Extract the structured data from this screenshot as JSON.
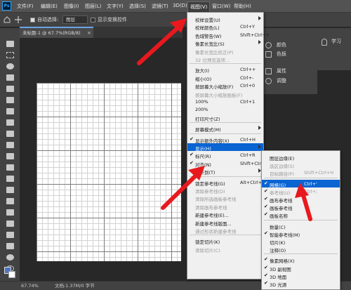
{
  "menubar": {
    "items": [
      "文件(F)",
      "编辑(E)",
      "图像(I)",
      "图层(L)",
      "文字(Y)",
      "选择(S)",
      "滤镜(T)",
      "3D(D)",
      "视图(V)",
      "窗口(W)",
      "帮助(H)"
    ]
  },
  "options": {
    "auto_select": "自动选择:",
    "layer_select": "图层",
    "show_transform": "显示变换控件"
  },
  "doc": {
    "tab": "未标题-1 @ 67.7%(RGB/8)",
    "close": "×"
  },
  "status": {
    "zoom": "67.74%",
    "docinfo": "文档:1.37M/0 字节"
  },
  "panels": {
    "color": "颜色",
    "swatches": "色板",
    "learn": "学习",
    "properties": "属性",
    "adjustments": "调整"
  },
  "view_menu": {
    "items": [
      {
        "label": "校样设置(U)",
        "shortcut": "",
        "arrow": true
      },
      {
        "label": "校样颜色(L)",
        "shortcut": "Ctrl+Y"
      },
      {
        "label": "色域警告(W)",
        "shortcut": "Shift+Ctrl+Y"
      },
      {
        "label": "像素长宽比(S)",
        "shortcut": "",
        "arrow": true
      },
      {
        "label": "像素长宽比校正(P)",
        "shortcut": "",
        "disabled": true
      },
      {
        "label": "32 位预览选项...",
        "shortcut": "",
        "disabled": true
      },
      {
        "label": "放大(I)",
        "shortcut": "Ctrl++"
      },
      {
        "label": "缩小(O)",
        "shortcut": "Ctrl+-"
      },
      {
        "label": "按屏幕大小缩放(F)",
        "shortcut": "Ctrl+0"
      },
      {
        "label": "按屏幕大小缩放画板(F)",
        "shortcut": "",
        "disabled": true
      },
      {
        "label": "100%",
        "shortcut": "Ctrl+1"
      },
      {
        "label": "200%",
        "shortcut": ""
      },
      {
        "label": "打印尺寸(Z)",
        "shortcut": ""
      },
      {
        "label": "屏幕模式(M)",
        "shortcut": "",
        "arrow": true
      },
      {
        "label": "显示额外内容(X)",
        "shortcut": "Ctrl+H",
        "checked": true
      },
      {
        "label": "显示(H)",
        "shortcut": "",
        "arrow": true,
        "highlighted": true
      },
      {
        "label": "标尺(R)",
        "shortcut": "Ctrl+R",
        "checked": true
      },
      {
        "label": "对齐(N)",
        "shortcut": "Shift+Ctrl+;",
        "checked": true
      },
      {
        "label": "对齐到(T)",
        "shortcut": "",
        "arrow": true
      },
      {
        "label": "锁定参考线(G)",
        "shortcut": "Alt+Ctrl+;"
      },
      {
        "label": "清除参考线(D)",
        "shortcut": "",
        "disabled": true
      },
      {
        "label": "清除所选画板参考线",
        "shortcut": "",
        "disabled": true
      },
      {
        "label": "清除画布参考线",
        "shortcut": "",
        "disabled": true
      },
      {
        "label": "新建参考线(E)...",
        "shortcut": ""
      },
      {
        "label": "新建参考线版面...",
        "shortcut": ""
      },
      {
        "label": "通过形状新建参考线",
        "shortcut": "",
        "disabled": true
      },
      {
        "label": "锁定切片(K)",
        "shortcut": ""
      },
      {
        "label": "清除切片(C)",
        "shortcut": "",
        "disabled": true
      }
    ]
  },
  "show_menu": {
    "items": [
      {
        "label": "图层边缘(E)",
        "shortcut": ""
      },
      {
        "label": "选区边缘(S)",
        "shortcut": "",
        "disabled": true
      },
      {
        "label": "目标路径(P)",
        "shortcut": "Shift+Ctrl+H",
        "disabled": true
      },
      {
        "label": "网格(G)",
        "shortcut": "Ctrl+'",
        "checked": true,
        "highlighted": true
      },
      {
        "label": "参考线(U)",
        "shortcut": "Ctrl+;",
        "checked": true,
        "disabled": true
      },
      {
        "label": "画布参考线",
        "shortcut": "",
        "checked": true
      },
      {
        "label": "画板参考线",
        "shortcut": "",
        "checked": true
      },
      {
        "label": "画板名称",
        "shortcut": "",
        "checked": true
      },
      {
        "label": "数量(C)",
        "shortcut": ""
      },
      {
        "label": "智能参考线(M)",
        "shortcut": "",
        "checked": true
      },
      {
        "label": "切片(K)",
        "shortcut": ""
      },
      {
        "label": "注释(O)",
        "shortcut": ""
      },
      {
        "label": "像素网格(X)",
        "shortcut": "",
        "checked": true
      },
      {
        "label": "3D 副视图",
        "shortcut": "",
        "checked": true
      },
      {
        "label": "3D 地面",
        "shortcut": "",
        "checked": true
      },
      {
        "label": "3D 光源",
        "shortcut": "",
        "checked": true
      }
    ]
  },
  "colors": {
    "accent": "#0a64d2",
    "arrow": "#e8191e"
  }
}
